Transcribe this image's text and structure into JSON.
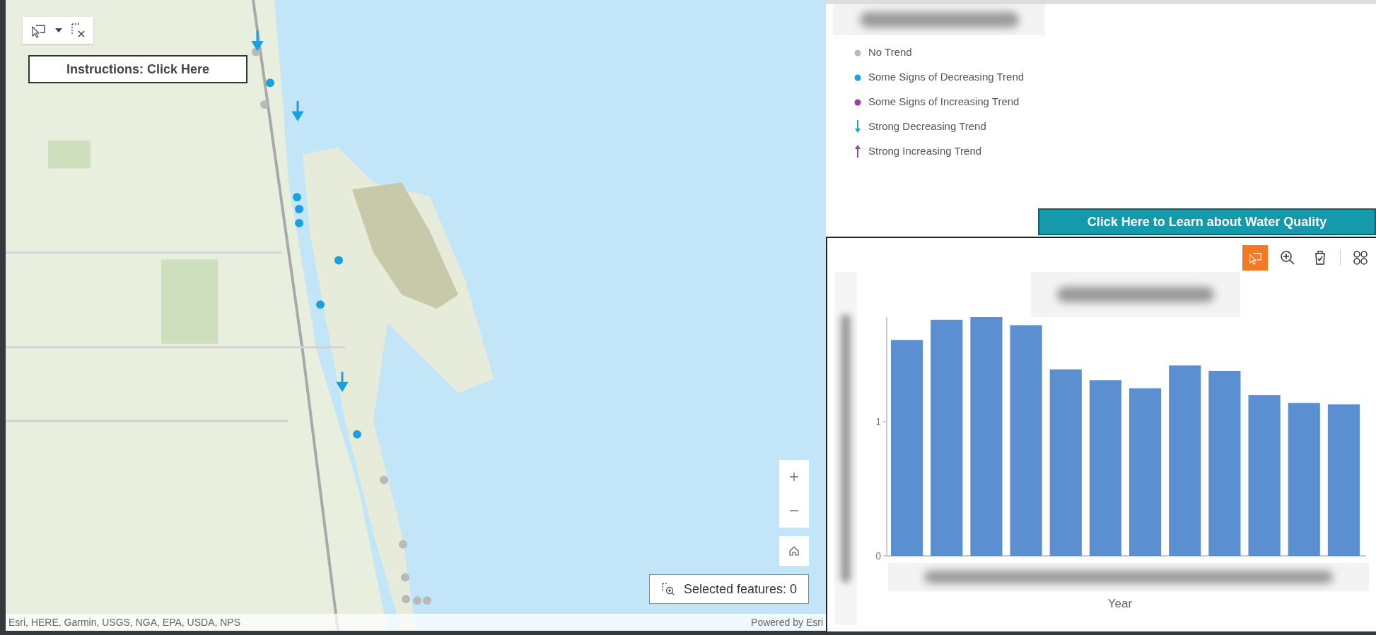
{
  "map": {
    "instructions_button": "Instructions: Click Here",
    "selected_features": "Selected features: 0",
    "attribution": "Esri, HERE, Garmin, USGS, NGA, EPA, USDA, NPS",
    "powered_by": "Powered by Esri"
  },
  "legend": {
    "items": [
      {
        "label": "No Trend",
        "kind": "dot",
        "color": "#b9b9b9"
      },
      {
        "label": "Some Signs of Decreasing Trend",
        "kind": "dot",
        "color": "#1a9fe0"
      },
      {
        "label": "Some Signs of Increasing Trend",
        "kind": "dot",
        "color": "#9b3fa8"
      },
      {
        "label": "Strong Decreasing Trend",
        "kind": "arrow-down",
        "color": "#1a9fe0"
      },
      {
        "label": "Strong Increasing Trend",
        "kind": "arrow-up",
        "color": "#9b3fa8"
      }
    ]
  },
  "learn_button": "Click Here to Learn about Water Quality",
  "chart_panel": {
    "tools": [
      {
        "kind": "select",
        "selected": true
      },
      {
        "kind": "zoom",
        "selected": false
      },
      {
        "kind": "clear",
        "selected": false
      },
      {
        "kind": "grid",
        "selected": false
      }
    ],
    "chart_data": {
      "type": "bar",
      "xlabel": "Year",
      "yticks": [
        0,
        1
      ],
      "ylim": [
        0,
        1.78
      ],
      "series": [
        {
          "color": "#5b8fd1",
          "values": [
            1.61,
            1.76,
            1.78,
            1.72,
            1.39,
            1.31,
            1.25,
            1.42,
            1.38,
            1.2,
            1.14,
            1.13
          ]
        }
      ]
    }
  }
}
